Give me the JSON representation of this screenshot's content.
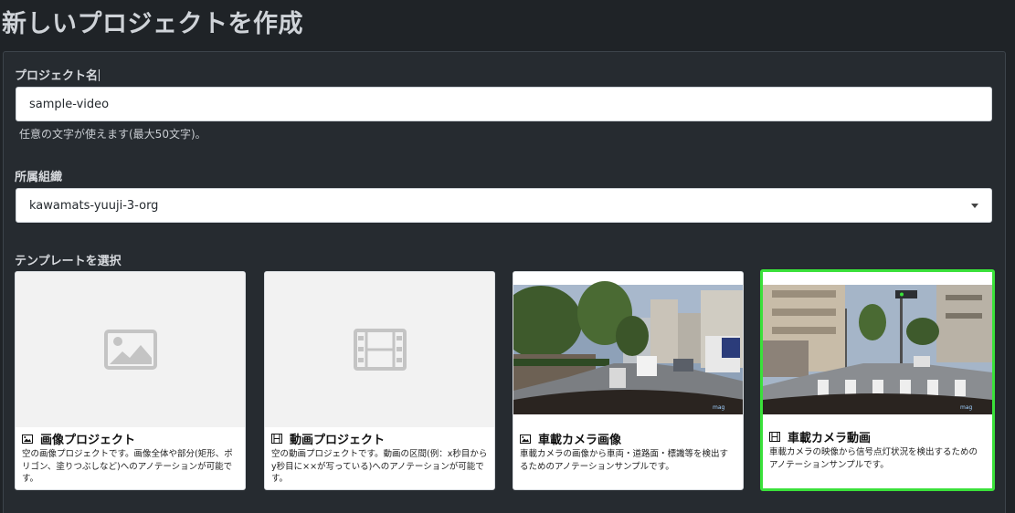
{
  "page": {
    "title": "新しいプロジェクトを作成"
  },
  "form": {
    "project_name": {
      "label": "プロジェクト名",
      "value": "sample-video",
      "hint": "任意の文字が使えます(最大50文字)。"
    },
    "organization": {
      "label": "所属組織",
      "value": "kawamats-yuuji-3-org"
    },
    "template": {
      "label": "テンプレートを選択",
      "cards": [
        {
          "title": "画像プロジェクト",
          "icon": "image-icon",
          "description": "空の画像プロジェクトです。画像全体や部分(矩形、ポリゴン、塗りつぶしなど)へのアノテーションが可能です。",
          "selected": false
        },
        {
          "title": "動画プロジェクト",
          "icon": "film-icon",
          "description": "空の動画プロジェクトです。動画の区間(例：x秒目からy秒目に××が写っている)へのアノテーションが可能です。",
          "selected": false
        },
        {
          "title": "車載カメラ画像",
          "icon": "image-icon",
          "description": "車載カメラの画像から車両・道路面・標識等を検出するためのアノテーションサンプルです。",
          "selected": false
        },
        {
          "title": "車載カメラ動画",
          "icon": "film-icon",
          "description": "車載カメラの映像から信号点灯状況を検出するためのアノテーションサンプルです。",
          "selected": true
        }
      ]
    }
  },
  "colors": {
    "background": "#1f2327",
    "panel": "#262b30",
    "selected_border": "#3ae13a"
  }
}
